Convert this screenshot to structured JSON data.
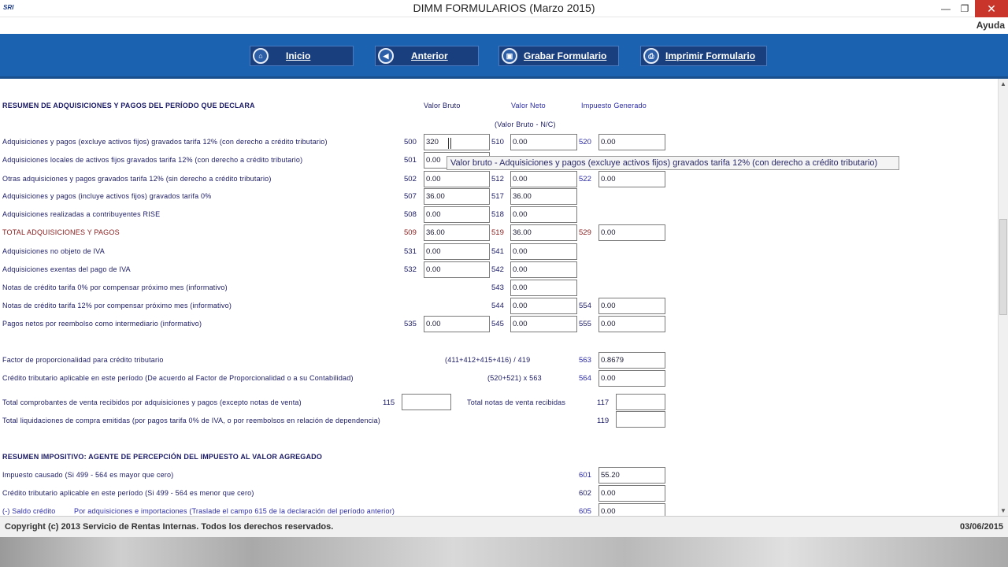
{
  "window": {
    "logo": "SRI",
    "title": "DIMM FORMULARIOS (Marzo 2015)"
  },
  "menu": {
    "help": "Ayuda"
  },
  "toolbar": {
    "home": "Inicio",
    "previous": "Anterior",
    "save": "Grabar Formulario",
    "print": "Imprimir Formulario"
  },
  "section1": {
    "title": "RESUMEN DE ADQUISICIONES Y PAGOS DEL PERÍODO QUE DECLARA",
    "col_gross": "Valor Bruto",
    "col_net": "Valor Neto",
    "col_net_sub": "(Valor Bruto - N/C)",
    "col_tax": "Impuesto Generado"
  },
  "rows": [
    {
      "label": "Adquisiciones y pagos (excluye activos fijos) gravados tarifa 12% (con derecho a crédito tributario)",
      "c1": "500",
      "v1": "320",
      "c2": "510",
      "v2": "0.00",
      "c3": "520",
      "v3": "0.00"
    },
    {
      "label": "Adquisiciones locales de activos fijos gravados tarifa 12% (con derecho a crédito tributario)",
      "c1": "501",
      "v1": "0.00"
    },
    {
      "label": "Otras adquisiciones y pagos gravados tarifa 12% (sin derecho a crédito tributario)",
      "c1": "502",
      "v1": "0.00",
      "c2": "512",
      "v2": "0.00",
      "c3": "522",
      "v3": "0.00"
    },
    {
      "label": "Adquisiciones y pagos (incluye activos fijos) gravados tarifa 0%",
      "c1": "507",
      "v1": "36.00",
      "c2": "517",
      "v2": "36.00"
    },
    {
      "label": "Adquisiciones realizadas a contribuyentes RISE",
      "c1": "508",
      "v1": "0.00",
      "c2": "518",
      "v2": "0.00"
    },
    {
      "label": "TOTAL ADQUISICIONES Y PAGOS",
      "c1": "509",
      "v1": "36.00",
      "c2": "519",
      "v2": "36.00",
      "c3": "529",
      "v3": "0.00"
    },
    {
      "label": "Adquisiciones no objeto de IVA",
      "c1": "531",
      "v1": "0.00",
      "c2": "541",
      "v2": "0.00"
    },
    {
      "label": "Adquisiciones exentas del pago de IVA",
      "c1": "532",
      "v1": "0.00",
      "c2": "542",
      "v2": "0.00"
    },
    {
      "label": "Notas de crédito tarifa 0% por compensar próximo mes (informativo)",
      "c2": "543",
      "v2": "0.00"
    },
    {
      "label": "Notas de crédito tarifa 12% por compensar próximo mes (informativo)",
      "c2": "544",
      "v2": "0.00",
      "c3": "554",
      "v3": "0.00"
    },
    {
      "label": "Pagos netos por reembolso como intermediario (informativo)",
      "c1": "535",
      "v1": "0.00",
      "c2": "545",
      "v2": "0.00",
      "c3": "555",
      "v3": "0.00"
    }
  ],
  "tooltip": "Valor bruto - Adquisiciones y pagos (excluye activos fijos) gravados tarifa 12% (con derecho a crédito tributario)",
  "factor": {
    "label": "Factor de proporcionalidad para crédito tributario",
    "formula": "(411+412+415+416) / 419",
    "code": "563",
    "value": "0.8679"
  },
  "credit": {
    "label": "Crédito tributario aplicable en este período (De acuerdo al Factor de Proporcionalidad o a su Contabilidad)",
    "formula": "(520+521) x 563",
    "code": "564",
    "value": "0.00"
  },
  "vouchers": {
    "label": "Total comprobantes de venta recibidos por adquisiciones y pagos (excepto notas de venta)",
    "code": "115",
    "value": "",
    "notes_label": "Total notas de venta recibidas",
    "notes_code": "117",
    "notes_value": ""
  },
  "liquidations": {
    "label": "Total liquidaciones de compra emitidas (por pagos tarifa 0% de IVA, o por reembolsos en relación de dependencia)",
    "code": "119",
    "value": ""
  },
  "section2": {
    "title": "RESUMEN IMPOSITIVO: AGENTE DE PERCEPCIÓN DEL IMPUESTO AL VALOR AGREGADO",
    "rows": [
      {
        "label": "Impuesto causado (Si 499 - 564 es mayor que cero)",
        "code": "601",
        "value": "55.20"
      },
      {
        "label": "Crédito tributario aplicable en este período (Si 499 - 564 es menor que cero)",
        "code": "602",
        "value": "0.00"
      }
    ],
    "saldo_label": "(-) Saldo crédito",
    "saldo_detail": "Por adquisiciones e importaciones (Traslade el campo 615 de la declaración del período anterior)",
    "saldo_code": "605",
    "saldo_value": "0.00"
  },
  "footer": {
    "copyright": "Copyright (c) 2013 Servicio de Rentas Internas. Todos los derechos reservados.",
    "date": "03/06/2015"
  }
}
